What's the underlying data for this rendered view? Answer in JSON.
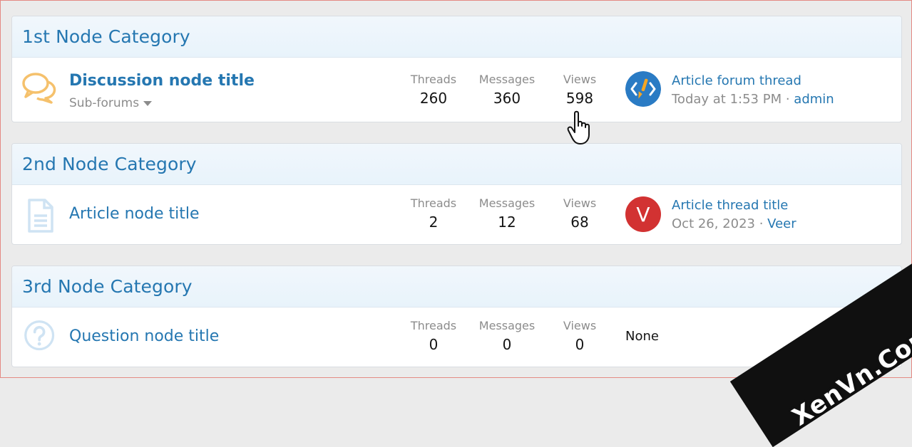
{
  "categories": [
    {
      "title": "1st Node Category",
      "node": {
        "title": "Discussion node title",
        "icon": "chat-bubbles-icon",
        "sub_forums": "Sub-forums",
        "stats": {
          "threads_label": "Threads",
          "threads": "260",
          "messages_label": "Messages",
          "messages": "360",
          "views_label": "Views",
          "views": "598"
        },
        "last_post": {
          "avatar_icon": "code-brush-avatar",
          "title": "Article forum thread",
          "date": "Today at 1:53 PM",
          "sep": " · ",
          "user": "admin"
        }
      }
    },
    {
      "title": "2nd Node Category",
      "node": {
        "title": "Article node title",
        "icon": "document-icon",
        "stats": {
          "threads_label": "Threads",
          "threads": "2",
          "messages_label": "Messages",
          "messages": "12",
          "views_label": "Views",
          "views": "68"
        },
        "last_post": {
          "avatar_letter": "V",
          "avatar_color": "#d23232",
          "title": "Article thread title",
          "date": "Oct 26, 2023",
          "sep": " · ",
          "user": "Veer"
        }
      }
    },
    {
      "title": "3rd Node Category",
      "node": {
        "title": "Question node title",
        "icon": "question-icon",
        "stats": {
          "threads_label": "Threads",
          "threads": "0",
          "messages_label": "Messages",
          "messages": "0",
          "views_label": "Views",
          "views": "0"
        },
        "last_post_none": "None"
      }
    }
  ],
  "watermark": "XenVn.Com",
  "colors": {
    "link": "#2577b1",
    "muted": "#8c8c8c",
    "chat_icon": "#f5c16c",
    "icon_light": "#cfe3f3"
  }
}
